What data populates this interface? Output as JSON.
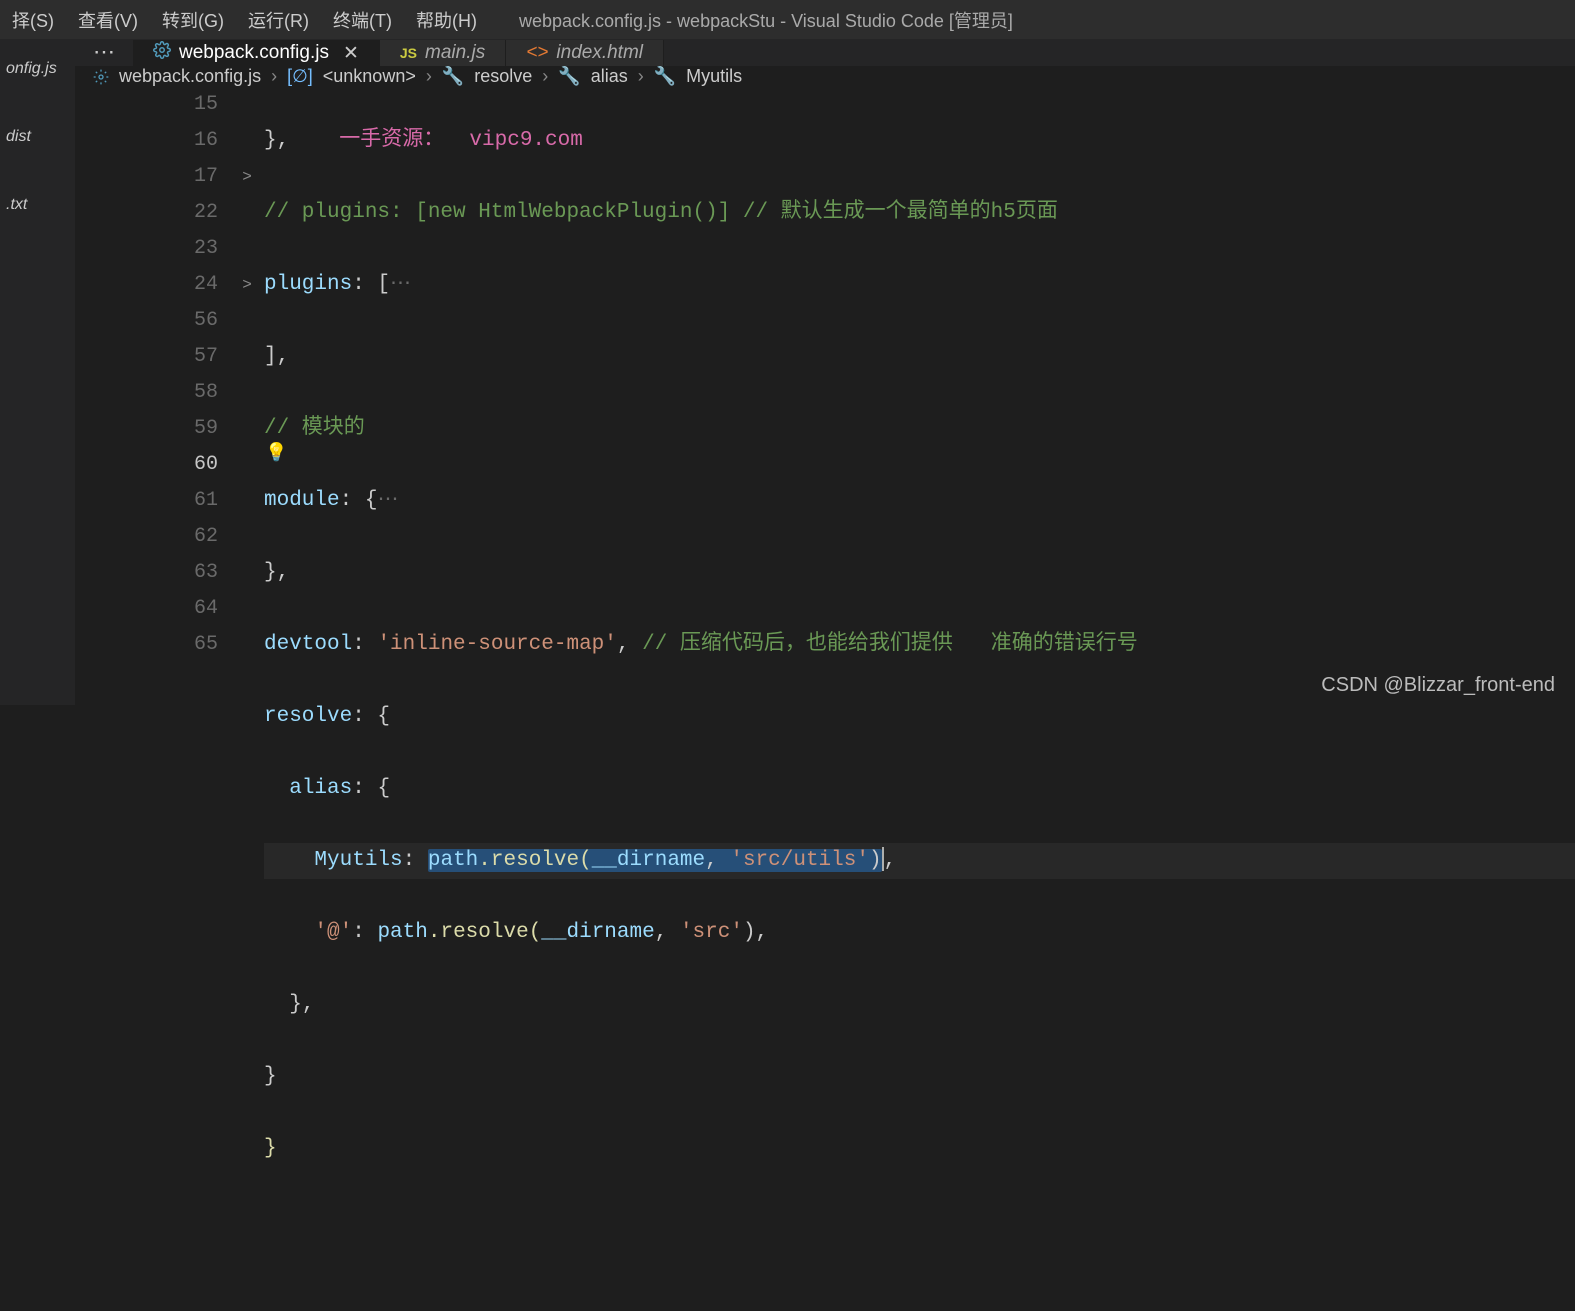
{
  "menu": {
    "items": [
      "择(S)",
      "查看(V)",
      "转到(G)",
      "运行(R)",
      "终端(T)",
      "帮助(H)"
    ],
    "window_title": "webpack.config.js - webpackStu - Visual Studio Code [管理员]"
  },
  "sidebar": {
    "items": [
      "onfig.js",
      "dist",
      ".txt"
    ]
  },
  "tabs": {
    "more": "⋯",
    "items": [
      {
        "label": "webpack.config.js",
        "icon": "gear",
        "active": true,
        "closeable": true
      },
      {
        "label": "main.js",
        "icon": "js",
        "active": false,
        "closeable": false
      },
      {
        "label": "index.html",
        "icon": "html",
        "active": false,
        "closeable": false
      }
    ]
  },
  "breadcrumbs": {
    "items": [
      {
        "icon": "gear",
        "label": "webpack.config.js"
      },
      {
        "icon": "bracket",
        "label": "<unknown>"
      },
      {
        "icon": "wrench",
        "label": "resolve"
      },
      {
        "icon": "wrench",
        "label": "alias"
      },
      {
        "icon": "wrench",
        "label": "Myutils"
      }
    ]
  },
  "overlay": {
    "text": "一手资源：  vipc9.com"
  },
  "code": {
    "lines": [
      {
        "num": "15",
        "fold": "",
        "text": "},"
      },
      {
        "num": "16",
        "fold": "",
        "comment": "// plugins: [new HtmlWebpackPlugin()] // 默认生成一个最简单的h5页面"
      },
      {
        "num": "17",
        "fold": ">",
        "key": "plugins",
        "after_colon": ": [",
        "folded": "⋯"
      },
      {
        "num": "22",
        "fold": "",
        "text": "],"
      },
      {
        "num": "23",
        "fold": "",
        "comment": "// 模块的"
      },
      {
        "num": "24",
        "fold": ">",
        "key": "module",
        "after_colon": ": {",
        "folded": "⋯"
      },
      {
        "num": "56",
        "fold": "",
        "text": "},"
      },
      {
        "num": "57",
        "fold": "",
        "key": "devtool",
        "after_colon": ": ",
        "str": "'inline-source-map'",
        "tail": ", ",
        "comment": "// 压缩代码后，也能给我们提供   准确的错误行号"
      },
      {
        "num": "58",
        "fold": "",
        "key": "resolve",
        "after_colon": ": {"
      },
      {
        "num": "59",
        "fold": "",
        "indent": "  ",
        "key": "alias",
        "after_colon": ": {"
      },
      {
        "num": "60",
        "fold": "",
        "active": true,
        "indent": "    ",
        "key": "Myutils",
        "after_colon": ": ",
        "sel_pre": "path",
        "sel_func": ".resolve(",
        "sel_var": "__dirname",
        "sel_mid": ", ",
        "sel_str": "'src/utils'",
        "sel_post": ")",
        "tail": ","
      },
      {
        "num": "61",
        "fold": "",
        "indent": "    ",
        "str_key": "'@'",
        "after_colon": ": ",
        "obj": "path",
        "func": ".resolve(",
        "var": "__dirname",
        "mid": ", ",
        "str": "'src'",
        "post": "),"
      },
      {
        "num": "62",
        "fold": "",
        "indent": "  ",
        "text": "},"
      },
      {
        "num": "63",
        "fold": "",
        "text": "}"
      },
      {
        "num": "64",
        "fold": "",
        "brace": "}"
      },
      {
        "num": "65",
        "fold": "",
        "text": ""
      }
    ]
  },
  "watermark": "CSDN @Blizzar_front-end"
}
